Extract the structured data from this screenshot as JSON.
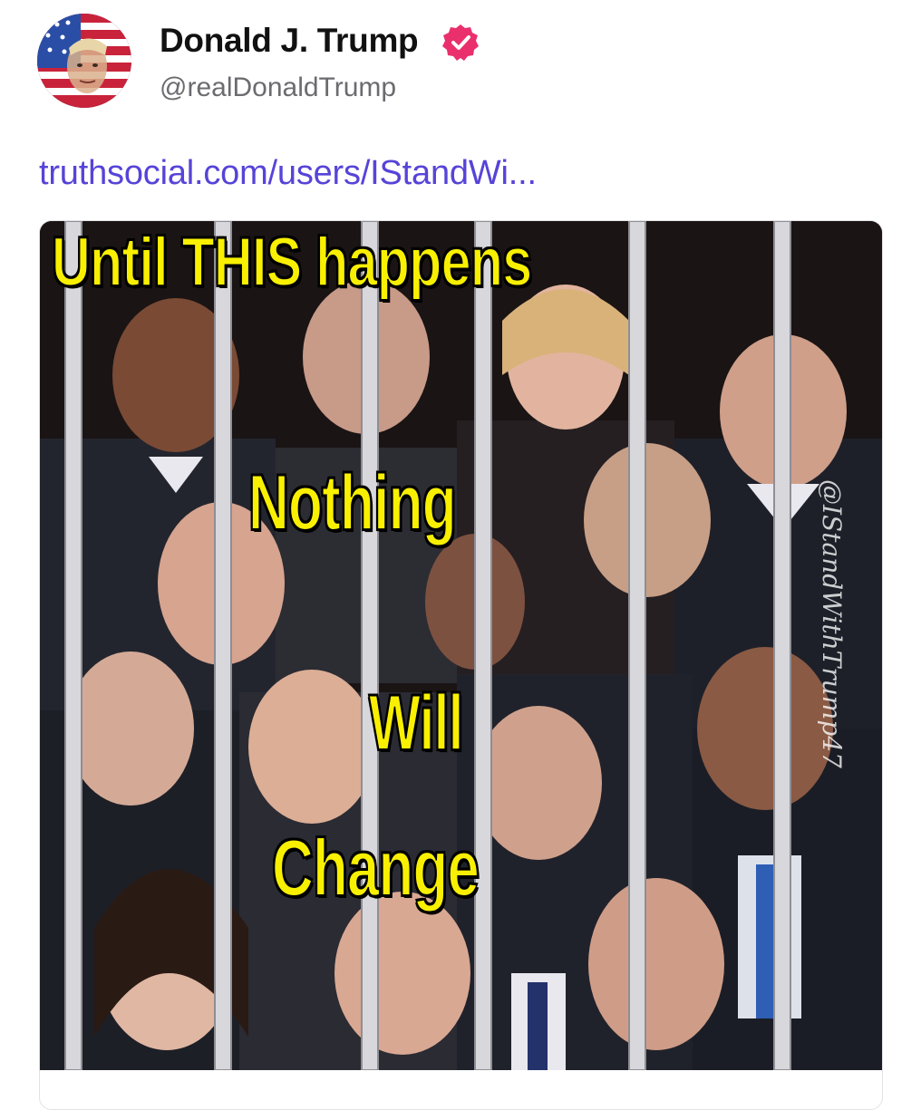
{
  "post": {
    "author": {
      "display_name": "Donald J. Trump",
      "handle": "@realDonaldTrump",
      "verified": true,
      "avatar_icon": "avatar-portrait-flag"
    },
    "link_text": "truthsocial.com/users/IStandWi...",
    "media": {
      "lines": [
        "Until THIS happens",
        "Nothing",
        "Will",
        "Change"
      ],
      "watermark": "@IStandWithTrump47"
    }
  },
  "colors": {
    "link": "#5644d8",
    "verified_badge": "#ea2f6d",
    "meme_text": "#f8f000",
    "handle": "#6b6b70"
  }
}
